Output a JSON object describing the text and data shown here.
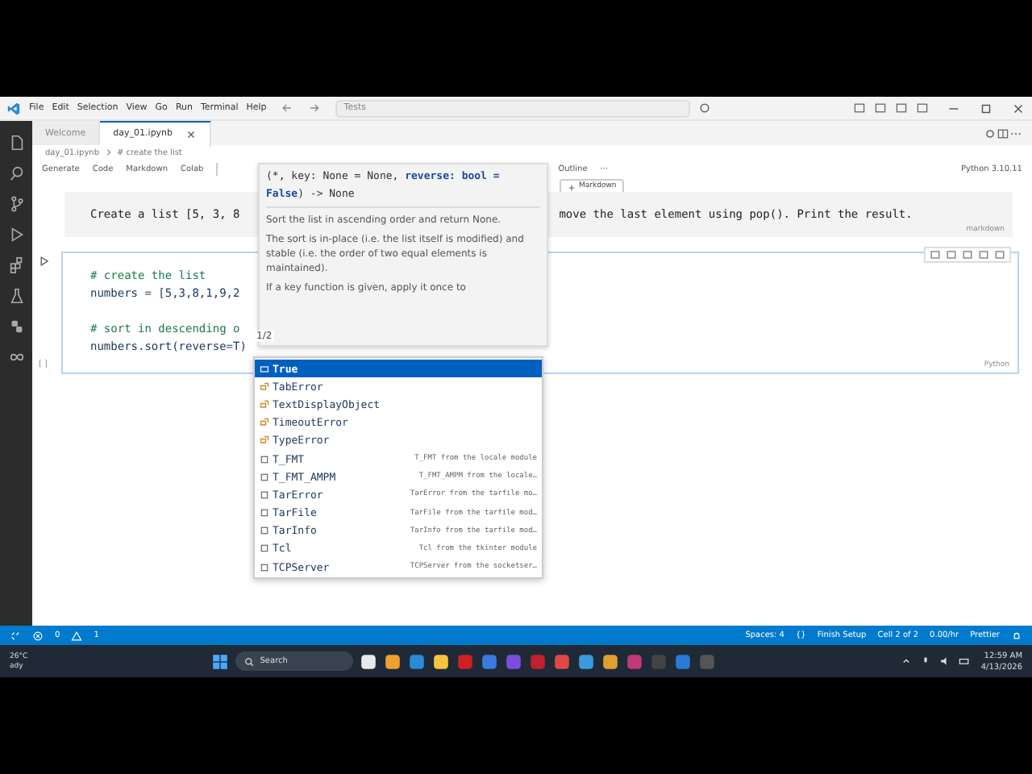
{
  "title_bar": {
    "menu": [
      "File",
      "Edit",
      "Selection",
      "View",
      "Go",
      "Run",
      "Terminal",
      "Help"
    ],
    "search": "Tests"
  },
  "tabs": [
    {
      "label": "Welcome",
      "selected": false
    },
    {
      "label": "day_01.ipynb",
      "selected": true
    }
  ],
  "breadcrumb": [
    "day_01.ipynb",
    "# create the list"
  ],
  "toolbar": {
    "items": [
      "Generate",
      "Code",
      "Markdown",
      "Colab"
    ],
    "outline": "Outline",
    "more": "···",
    "kernel": "Python 3.10.11"
  },
  "add_markdown": "Markdown",
  "markdown_cell": {
    "parts": [
      "Create a list [5, 3, 8",
      "move the last element using pop(). Print the result."
    ],
    "language": "markdown"
  },
  "code_cell": {
    "lines": [
      {
        "kind": "comment",
        "text": "# create the list"
      },
      {
        "kind": "code",
        "text": "numbers = [5,3,8,1,9,2"
      },
      {
        "kind": "blank"
      },
      {
        "kind": "comment",
        "text": "# sort in descending o"
      },
      {
        "kind": "code",
        "text": "numbers.sort(reverse=T)"
      }
    ],
    "execution": "[ ]",
    "language": "Python"
  },
  "signature_help": {
    "signature": "(*, key: None = None, **reverse: bool = False**) -> None",
    "paragraphs": [
      "Sort the list in ascending order and return None.",
      "The sort is in-place (i.e. the list itself is modified) and stable (i.e. the order of two equal elements is maintained).",
      "If a key function is given, apply it once to"
    ],
    "counter": "1/2"
  },
  "suggestions": [
    {
      "kind": "keyword",
      "label": "True",
      "selected": true
    },
    {
      "kind": "class",
      "label": "TabError",
      "selected": false
    },
    {
      "kind": "class",
      "label": "TextDisplayObject",
      "selected": false
    },
    {
      "kind": "class",
      "label": "TimeoutError",
      "selected": false
    },
    {
      "kind": "class",
      "label": "TypeError",
      "selected": false
    },
    {
      "kind": "variable",
      "label": "T_FMT",
      "detail": "T_FMT from the locale module",
      "selected": false
    },
    {
      "kind": "variable",
      "label": "T_FMT_AMPM",
      "detail": "T_FMT_AMPM from the locale…",
      "selected": false
    },
    {
      "kind": "variable",
      "label": "TarError",
      "detail": "TarError from the tarfile mo…",
      "selected": false
    },
    {
      "kind": "variable",
      "label": "TarFile",
      "detail": "TarFile from the tarfile mod…",
      "selected": false
    },
    {
      "kind": "variable",
      "label": "TarInfo",
      "detail": "TarInfo from the tarfile mod…",
      "selected": false
    },
    {
      "kind": "variable",
      "label": "Tcl",
      "detail": "Tcl from the tkinter module",
      "selected": false
    },
    {
      "kind": "variable",
      "label": "TCPServer",
      "detail": "TCPServer from the socketser…",
      "selected": false
    }
  ],
  "status_bar": {
    "errors": "0",
    "warnings": "1",
    "right": [
      "Spaces: 4",
      "{}",
      "Finish Setup",
      "Cell 2 of 2",
      "0.00/hr",
      "Prettier"
    ]
  },
  "taskbar": {
    "temperature": "26°C",
    "weather": "ady",
    "search": "Search",
    "time": "12:59 AM",
    "date": "4/13/2026"
  }
}
